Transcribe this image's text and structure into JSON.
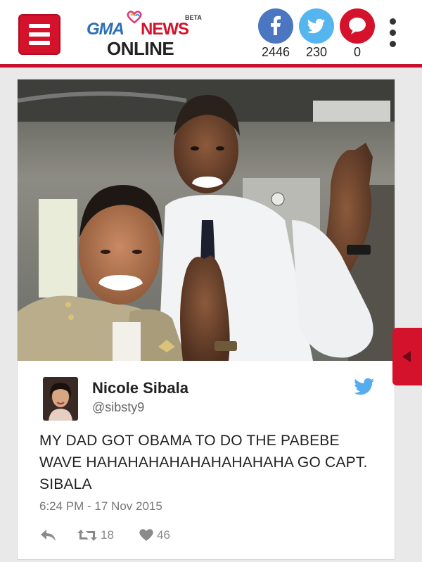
{
  "header": {
    "logo_gma": "GMA",
    "logo_news": "NEWS",
    "logo_online": "ONLINE",
    "logo_beta": "BETA",
    "share": {
      "facebook_count": "2446",
      "twitter_count": "230",
      "comments_count": "0"
    }
  },
  "tweet": {
    "name": "Nicole Sibala",
    "handle": "@sibsty9",
    "text": "MY DAD GOT OBAMA TO DO THE PABEBE WAVE HAHAHAHAHAHAHAHAHAHA GO CAPT. SIBALA",
    "timestamp": "6:24 PM - 17 Nov 2015",
    "retweets": "18",
    "likes": "46"
  },
  "colors": {
    "brand_red": "#d4122b",
    "facebook": "#3b5998",
    "twitter": "#55acee"
  },
  "icons": [
    "menu-icon",
    "facebook-icon",
    "twitter-icon",
    "comment-icon",
    "more-icon",
    "twitter-bird-icon",
    "reply-icon",
    "retweet-icon",
    "heart-icon",
    "collapse-arrow-icon"
  ]
}
